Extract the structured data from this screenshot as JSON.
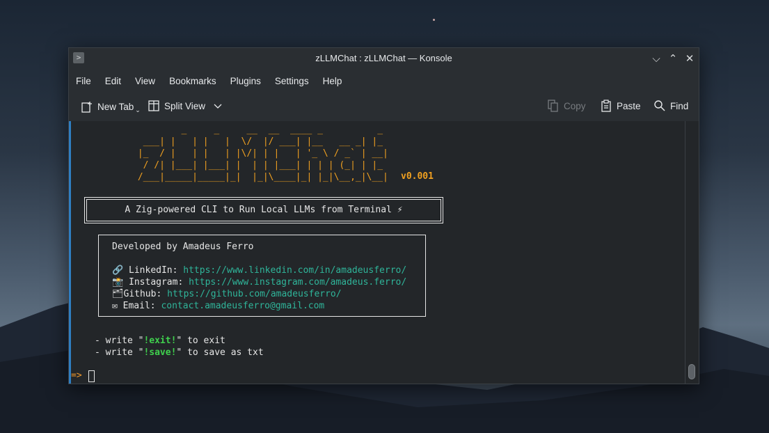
{
  "window": {
    "title": "zLLMChat : zLLMChat — Konsole",
    "app_icon_glyph": ">",
    "controls": {
      "minimize": "⌵",
      "maximize": "⌃",
      "close": "✕"
    }
  },
  "menu": [
    "File",
    "Edit",
    "View",
    "Bookmarks",
    "Plugins",
    "Settings",
    "Help"
  ],
  "toolbar": {
    "new_tab": "New Tab",
    "split_view": "Split View",
    "copy": "Copy",
    "paste": "Paste",
    "find": "Find"
  },
  "terminal": {
    "logo_art": "         _     _     __  __  ____ _          _\n  ___| |   | |   |  \\/  |/ ___| |__   __ _| |_\n |_  / |   | |   | |\\/| | |   | '_ \\ / _` | __|\n  / /| |___| |___| |  | | |___| | | | (_| | |_\n /___|_____|_____|_|  |_|\\____|_| |_|\\__,_|\\__|",
    "version": "v0.001",
    "tagline": "A Zig-powered CLI to Run Local LLMs from Terminal ⚡",
    "developer": {
      "heading": "Developed by Amadeus Ferro",
      "linkedin_label": "🔗 LinkedIn: ",
      "linkedin_url": "https://www.linkedin.com/in/amadeusferro/",
      "instagram_label": "📸 Instagram: ",
      "instagram_url": "https://www.instagram.com/amadeus.ferro/",
      "github_label": "🗂Github: ",
      "github_url": "https://github.com/amadeusferro/",
      "email_label": "✉ Email: ",
      "email_value": "contact.amadeusferro@gmail.com"
    },
    "hints": [
      {
        "prefix": "- write \"",
        "cmd": "!exit!",
        "suffix": "\" to exit"
      },
      {
        "prefix": "- write \"",
        "cmd": "!save!",
        "suffix": "\" to save as txt"
      }
    ],
    "prompt": "=>"
  },
  "colors": {
    "accent": "#2f7ec2",
    "logo": "#f0a020",
    "link": "#2fb59a",
    "command": "#3fd04d",
    "prompt": "#f39a2d"
  }
}
